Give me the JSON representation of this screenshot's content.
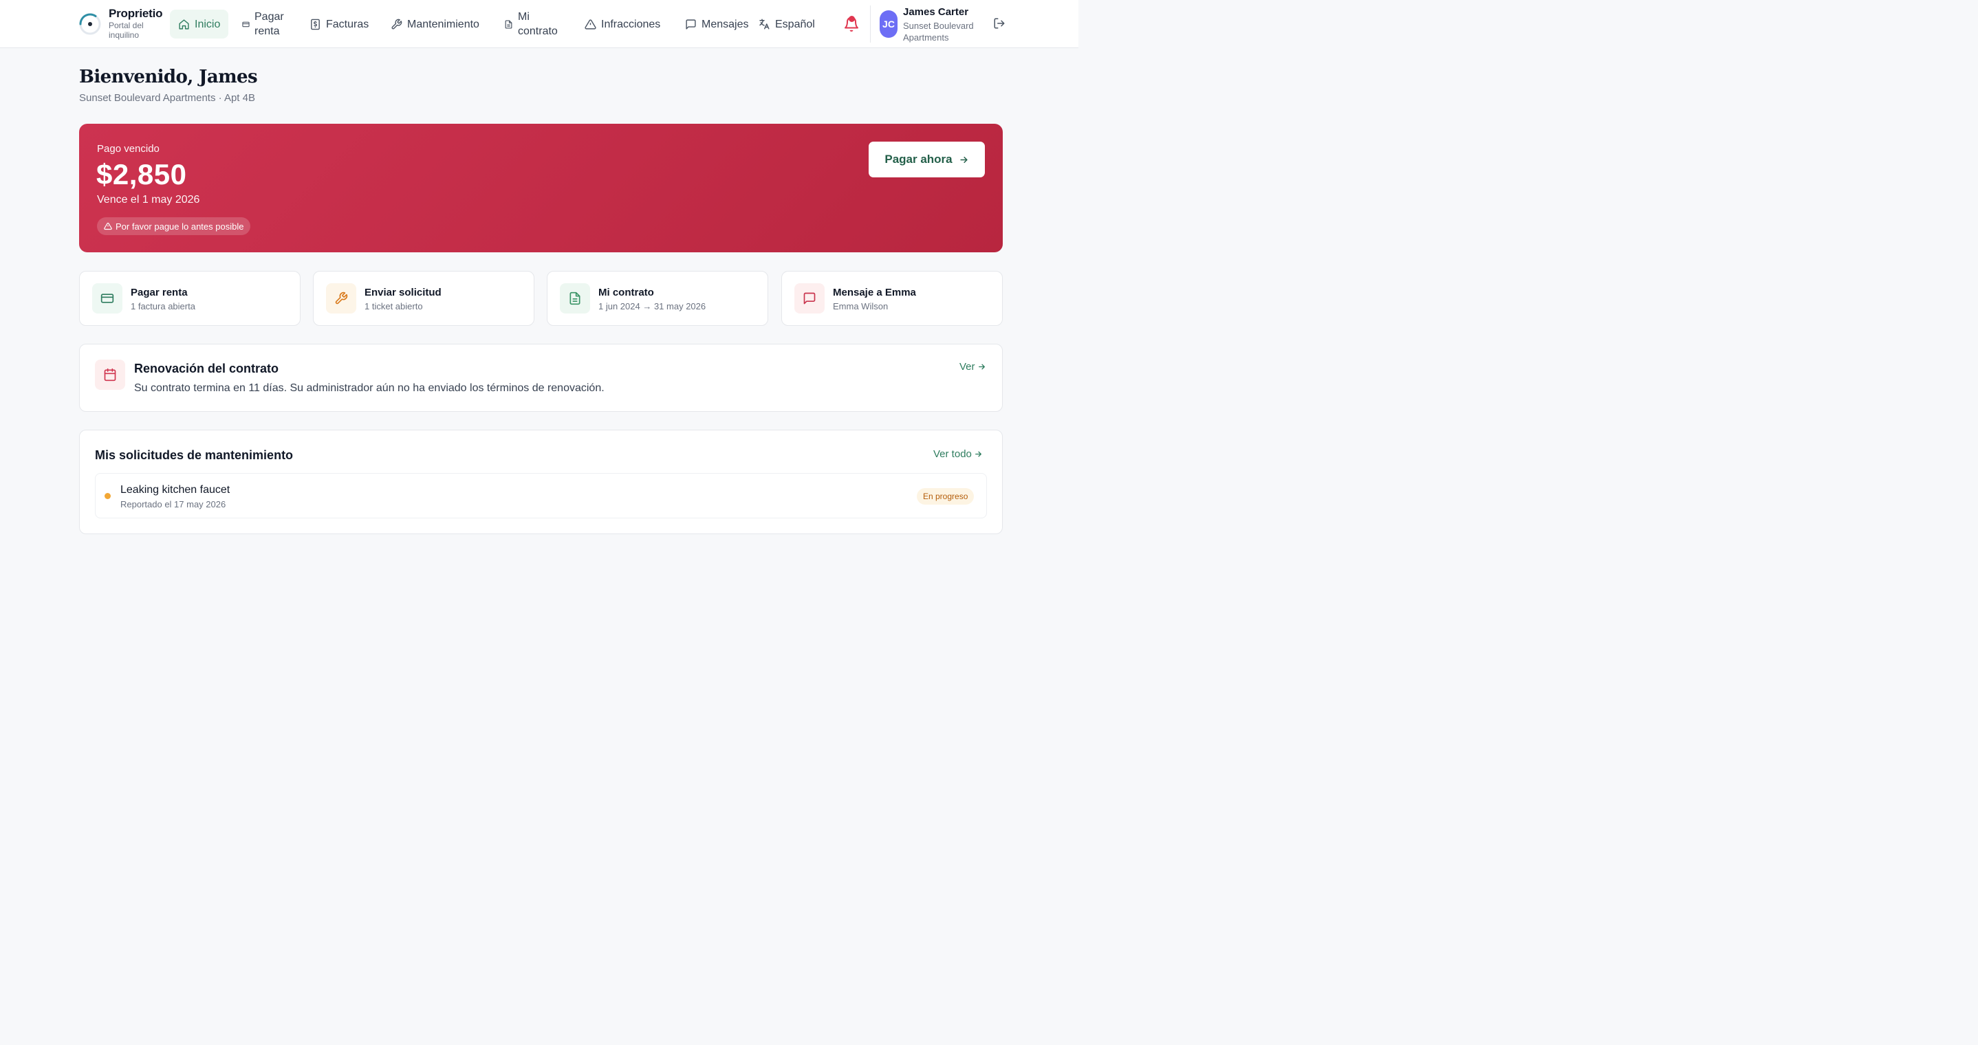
{
  "brand": {
    "name": "Proprietio",
    "subtitle": "Portal del inquilino"
  },
  "nav": {
    "home": "Inicio",
    "pay_rent": "Pagar renta",
    "invoices": "Facturas",
    "maintenance": "Mantenimiento",
    "contract": "Mi contrato",
    "infractions": "Infracciones",
    "messages": "Mensajes",
    "language": "Español"
  },
  "user": {
    "initials": "JC",
    "name": "James Carter",
    "property": "Sunset Boulevard Apartments"
  },
  "header": {
    "welcome": "Bienvenido, James",
    "subtitle": "Sunset Boulevard Apartments · Apt 4B"
  },
  "banner": {
    "label": "Pago vencido",
    "amount": "$2,850",
    "due": "Vence el 1 may 2026",
    "warning": "Por favor pague lo antes posible",
    "pay_button": "Pagar ahora"
  },
  "quick_actions": [
    {
      "title": "Pagar renta",
      "subtitle": "1 factura abierta"
    },
    {
      "title": "Enviar solicitud",
      "subtitle": "1 ticket abierto"
    },
    {
      "title": "Mi contrato",
      "subtitle": "1 jun 2024 → 31 may 2026"
    },
    {
      "title": "Mensaje a Emma",
      "subtitle": "Emma Wilson"
    }
  ],
  "renewal": {
    "title": "Renovación del contrato",
    "text": "Su contrato termina en 11 días. Su administrador aún no ha enviado los términos de renovación.",
    "link": "Ver"
  },
  "maintenance": {
    "title": "Mis solicitudes de mantenimiento",
    "link": "Ver todo",
    "items": [
      {
        "title": "Leaking kitchen faucet",
        "reported": "Reportado el 17 may 2026",
        "status": "En progreso"
      }
    ]
  },
  "colors": {
    "accent": "#2f7d5f",
    "danger": "#c22c47",
    "avatar": "#6d6ef5",
    "status_in_progress": "#b45d0a"
  },
  "icons": {
    "nav": [
      "home-icon",
      "card-icon",
      "invoice-icon",
      "wrench-icon",
      "document-icon",
      "warning-icon",
      "message-icon",
      "translate-icon"
    ],
    "quick_actions": [
      "credit-card-icon",
      "wrench-icon",
      "document-icon",
      "message-icon"
    ],
    "renewal": "calendar-icon"
  }
}
